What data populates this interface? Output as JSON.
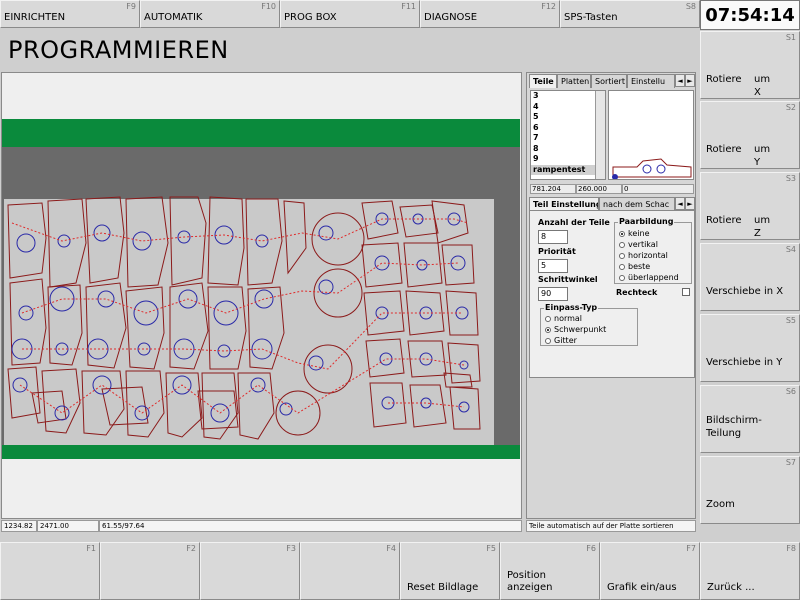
{
  "top_keys": [
    {
      "num": "F9",
      "label": "EINRICHTEN"
    },
    {
      "num": "F10",
      "label": "AUTOMATIK"
    },
    {
      "num": "F11",
      "label": "PROG BOX"
    },
    {
      "num": "F12",
      "label": "DIAGNOSE"
    },
    {
      "num": "S8",
      "label": "SPS-Tasten"
    }
  ],
  "clock": "07:54:14",
  "page_title": "PROGRAMMIEREN",
  "side_keys": [
    {
      "num": "S1",
      "label": "Rotiere",
      "label2": "um X"
    },
    {
      "num": "S2",
      "label": "Rotiere",
      "label2": "um Y"
    },
    {
      "num": "S3",
      "label": "Rotiere",
      "label2": "um Z"
    },
    {
      "num": "S4",
      "label": "Verschiebe in X",
      "label2": ""
    },
    {
      "num": "S5",
      "label": "Verschiebe in Y",
      "label2": ""
    },
    {
      "num": "S6",
      "label": "Bildschirm-\nTeilung",
      "label2": ""
    },
    {
      "num": "S7",
      "label": "Zoom",
      "label2": ""
    }
  ],
  "bottom_keys": [
    {
      "num": "F1",
      "label": ""
    },
    {
      "num": "F2",
      "label": ""
    },
    {
      "num": "F3",
      "label": ""
    },
    {
      "num": "F4",
      "label": ""
    },
    {
      "num": "F5",
      "label": "Reset Bildlage"
    },
    {
      "num": "F6",
      "label": "Position\nanzeigen"
    },
    {
      "num": "F7",
      "label": "Grafik ein/aus"
    },
    {
      "num": "F8",
      "label": "Zurück ..."
    }
  ],
  "status": {
    "x": "1234.82",
    "y": "2471.00",
    "ratio": "61.55/97.64",
    "hint": "Teile automatisch auf der Platte sortieren"
  },
  "panel": {
    "tabs": [
      "Teile",
      "Platten",
      "Sortiert",
      "Einstellu"
    ],
    "tab_left": "◄",
    "tab_right": "►",
    "list_items": [
      "3",
      "4",
      "5",
      "6",
      "7",
      "8",
      "9",
      "rampentest"
    ],
    "selected_item": "rampentest",
    "coords": [
      "781.204",
      "260.000",
      "0"
    ],
    "sub_tabs": [
      "Teil Einstellung",
      "nach dem Schac"
    ],
    "settings": {
      "count_label": "Anzahl der Teile",
      "count_value": "8",
      "priority_label": "Priorität",
      "priority_value": "5",
      "step_label": "Schrittwinkel",
      "step_value": "90",
      "pair_title": "Paarbildung",
      "pair_options": [
        "keine",
        "vertikal",
        "horizontal",
        "beste",
        "überlappend"
      ],
      "pair_selected": 0,
      "rect_label": "Rechteck",
      "fit_title": "Einpass-Typ",
      "fit_options": [
        "normal",
        "Schwerpunkt",
        "Gitter"
      ],
      "fit_selected": 1
    }
  },
  "colors": {
    "plate": "#c9c9c9",
    "green_band": "#0a8a3c",
    "dark_band": "#6a6a6a",
    "part_outline": "#8b1a1a",
    "hole": "#2a2aa8",
    "path": "#e02a2a"
  }
}
